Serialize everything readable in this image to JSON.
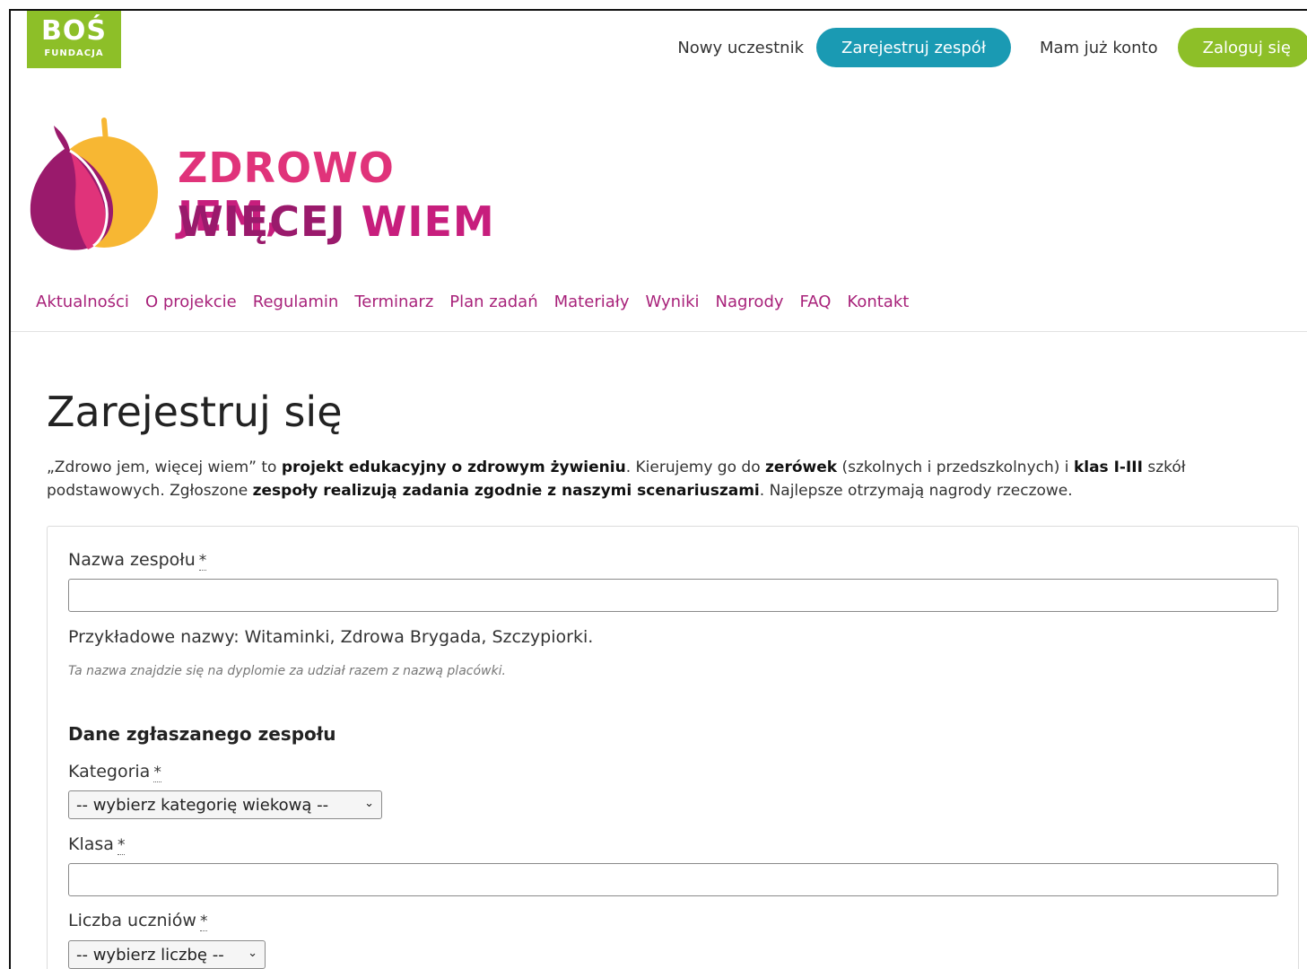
{
  "header": {
    "logo_bos": "BOŚ",
    "logo_fundacja": "FUNDACJA",
    "new_participant": "Nowy uczestnik",
    "register_team": "Zarejestruj zespół",
    "have_account": "Mam już konto",
    "login": "Zaloguj się"
  },
  "brand": {
    "line1_a": "ZDROWO ",
    "line1_b": "JEM,",
    "line2_a": "WIĘCEJ ",
    "line2_b": "WIEM"
  },
  "nav": [
    "Aktualności",
    "O projekcie",
    "Regulamin",
    "Terminarz",
    "Plan zadań",
    "Materiały",
    "Wyniki",
    "Nagrody",
    "FAQ",
    "Kontakt"
  ],
  "page": {
    "title": "Zarejestruj się",
    "intro": [
      {
        "t": "„Zdrowo jem, więcej wiem” to ",
        "b": false
      },
      {
        "t": "projekt edukacyjny o zdrowym żywieniu",
        "b": true
      },
      {
        "t": ". Kierujemy go do ",
        "b": false
      },
      {
        "t": "zerówek",
        "b": true
      },
      {
        "t": " (szkolnych i przedszkolnych) i ",
        "b": false
      },
      {
        "t": "klas I-III",
        "b": true
      },
      {
        "t": " szkół podstawowych. Zgłoszone ",
        "b": false
      },
      {
        "t": "zespoły realizują zadania zgodnie z naszymi scenariuszami",
        "b": true
      },
      {
        "t": ". Najlepsze otrzymają nagrody rzeczowe.",
        "b": false
      }
    ]
  },
  "form": {
    "team_name_label": "Nazwa zespołu",
    "required_mark": "*",
    "team_name_value": "",
    "examples": "Przykładowe nazwy: Witaminki, Zdrowa Brygada, Szczypiorki.",
    "examples_note": "Ta nazwa znajdzie się na dyplomie za udział razem z nazwą placówki.",
    "section_title": "Dane zgłaszanego zespołu",
    "category_label": "Kategoria",
    "category_selected": "-- wybierz kategorię wiekową --",
    "class_label": "Klasa",
    "class_value": "",
    "students_label": "Liczba uczniów",
    "students_selected": "-- wybierz liczbę --"
  }
}
